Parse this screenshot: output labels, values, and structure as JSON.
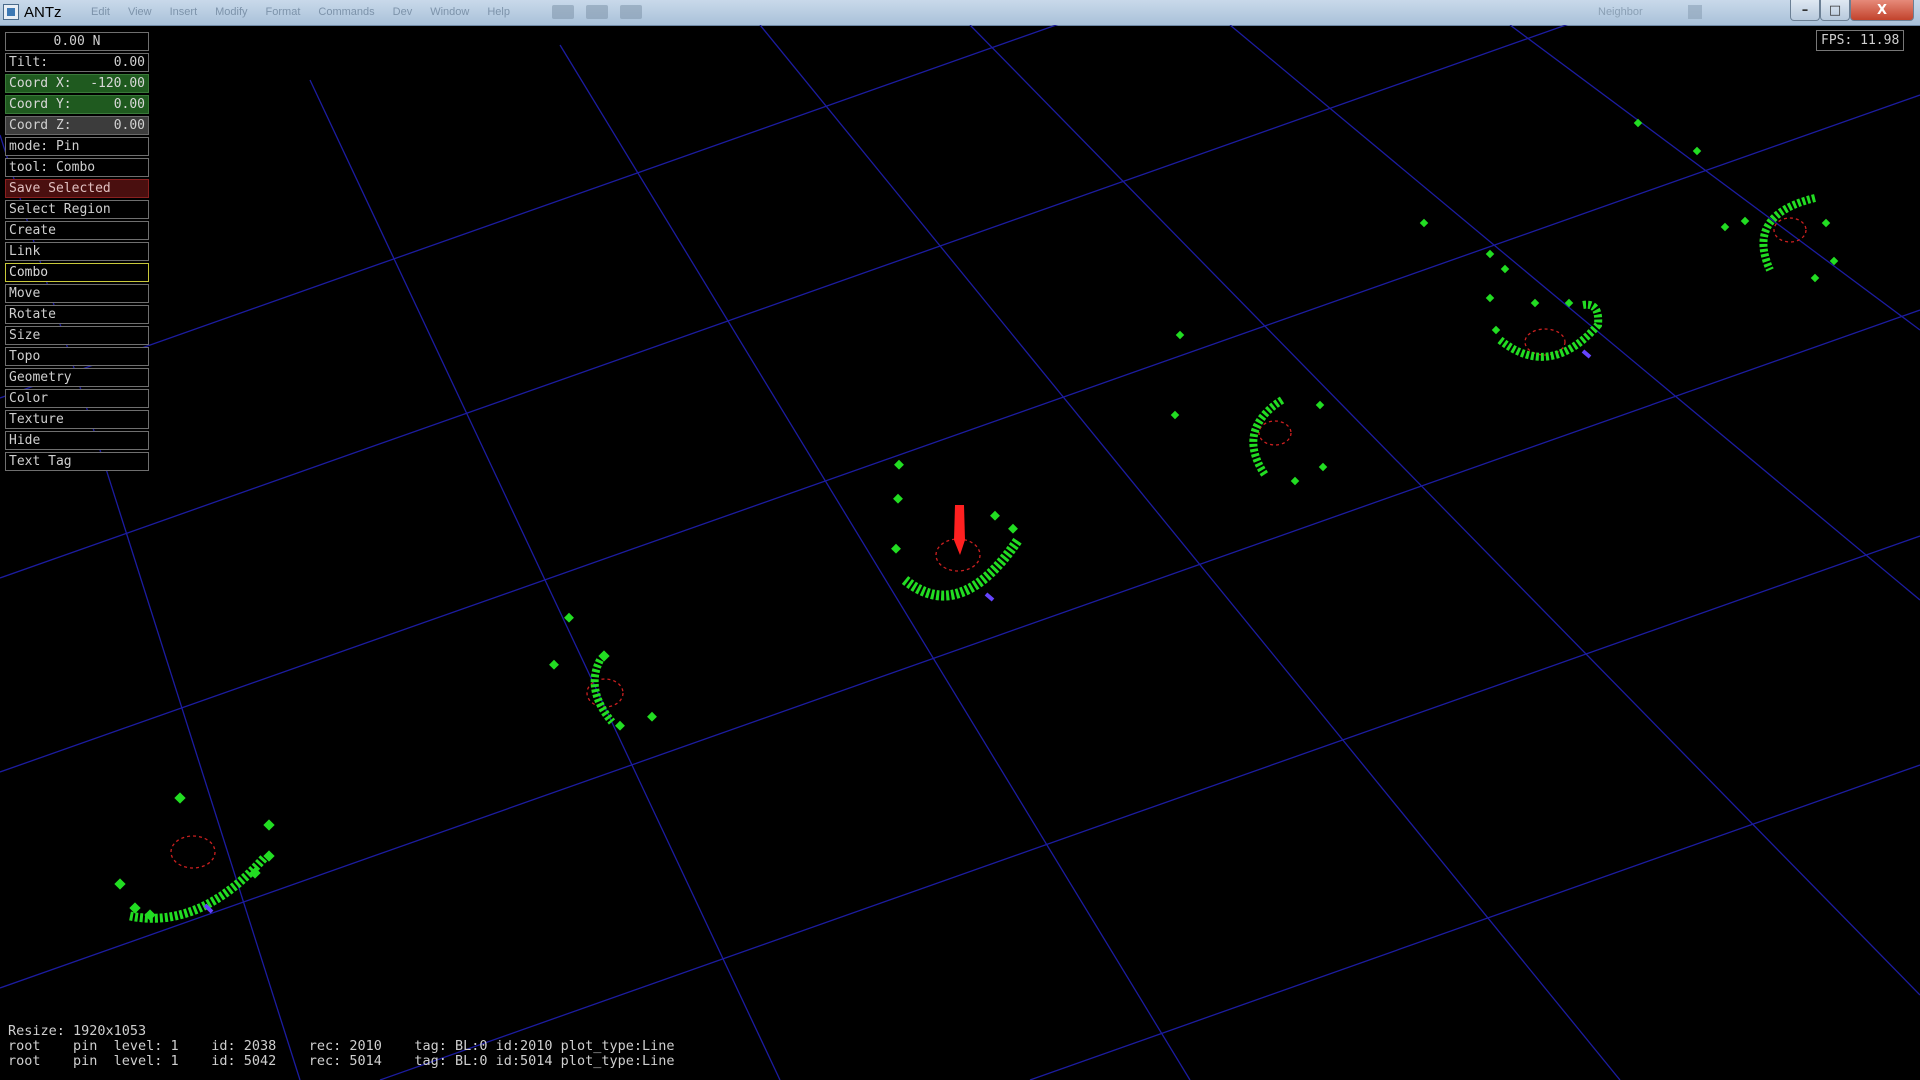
{
  "window": {
    "title": "ANTz",
    "menu": [
      "Edit",
      "View",
      "Insert",
      "Modify",
      "Format",
      "Commands",
      "Dev",
      "Window",
      "Help"
    ],
    "toolbar_icons": [
      "camera-icon",
      "gear-icon",
      "user-icon"
    ],
    "right_text": "Neighbor",
    "controls": {
      "minimize": "–",
      "maximize": "□",
      "close": "X"
    }
  },
  "panel": {
    "heading": "0.00 N",
    "tilt": {
      "label": "Tilt:",
      "value": "0.00"
    },
    "coord_x": {
      "label": "Coord X:",
      "value": "-120.00"
    },
    "coord_y": {
      "label": "Coord Y:",
      "value": "0.00"
    },
    "coord_z": {
      "label": "Coord Z:",
      "value": "0.00"
    },
    "mode": "mode: Pin",
    "tool": "tool: Combo",
    "buttons": [
      "Save Selected",
      "Select Region",
      "Create",
      "Link",
      "Combo",
      "Move",
      "Rotate",
      "Size",
      "Topo",
      "Geometry",
      "Color",
      "Texture",
      "Hide",
      "Text Tag"
    ],
    "selected_button": "Combo"
  },
  "fps": "FPS: 11.98",
  "status": {
    "line1": "Resize: 1920x1053",
    "line2": "root    pin  level: 1    id: 2038    rec: 2010    tag: BL:0 id:2010 plot_type:Line",
    "line3": "root    pin  level: 1    id: 5042    rec: 5014    tag: BL:0 id:5014 plot_type:Line"
  },
  "colors": {
    "grid": "#1c1ca0",
    "glyph": "#22dd22",
    "selected": "#ff2020",
    "ring": "#cc2020"
  }
}
